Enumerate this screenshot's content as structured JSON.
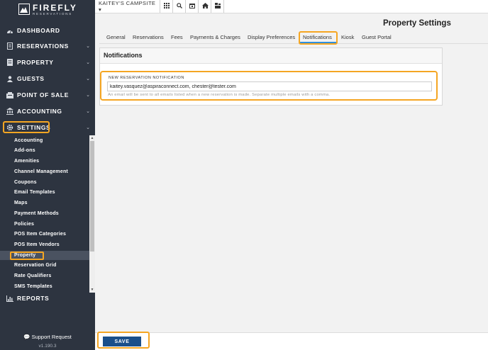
{
  "brand": {
    "name": "FIREFLY",
    "sub": "RESERVATIONS"
  },
  "topbar": {
    "campsite": "KAITEY'S CAMPSITE ▾",
    "buttons": [
      "grid-icon",
      "search-icon",
      "calendar-icon",
      "home-icon",
      "users-icon"
    ]
  },
  "nav": {
    "dashboard": "DASHBOARD",
    "reservations": "RESERVATIONS",
    "property": "PROPERTY",
    "guests": "GUESTS",
    "pos": "POINT OF SALE",
    "accounting": "ACCOUNTING",
    "settings": "SETTINGS",
    "reports": "REPORTS"
  },
  "settings_sub": [
    "Accounting",
    "Add-ons",
    "Amenities",
    "Channel Management",
    "Coupons",
    "Email Templates",
    "Maps",
    "Payment Methods",
    "Policies",
    "POS Item Categories",
    "POS Item Vendors",
    "Property",
    "Reservation Grid",
    "Rate Qualifiers",
    "SMS Templates"
  ],
  "support": "Support Request",
  "version": "v1.190.3",
  "page_title": "Property Settings",
  "tabs": [
    "General",
    "Reservations",
    "Fees",
    "Payments & Charges",
    "Display Preferences",
    "Notifications",
    "Kiosk",
    "Guest Portal"
  ],
  "active_tab": "Notifications",
  "panel": {
    "title": "Notifications",
    "field_label": "NEW RESERVATION NOTIFICATION",
    "field_value": "kaitey.vasquez@aspiraconnect.com, chester@tester.com",
    "field_help": "An email will be sent to all emails listed when a new reservation is made. Separate multiple emails with a comma."
  },
  "save_label": "SAVE",
  "colors": {
    "sidebar": "#2d3440",
    "highlight": "#f5a623",
    "save": "#1a4f8a",
    "tab_underline": "#2f8fdd"
  }
}
